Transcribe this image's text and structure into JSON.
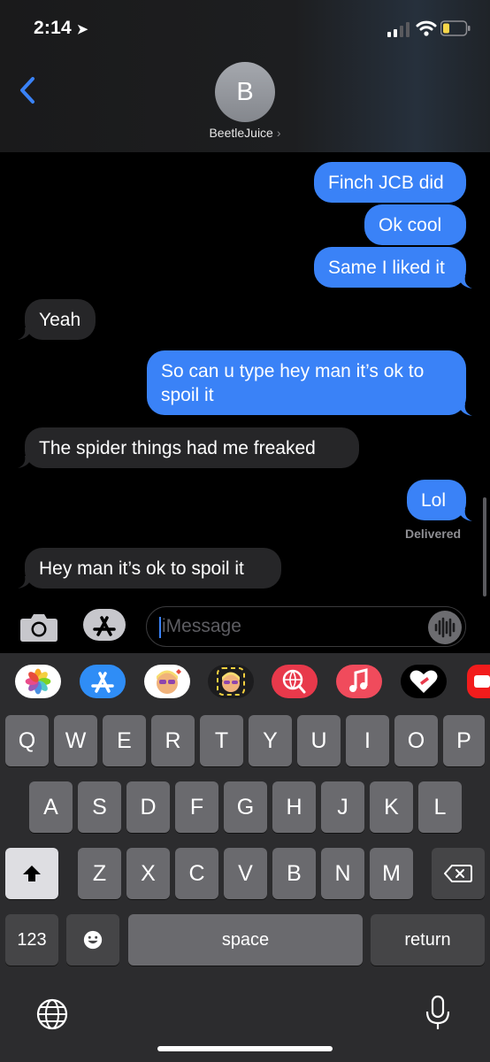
{
  "status_bar": {
    "time": "2:14"
  },
  "header": {
    "avatar_initial": "B",
    "contact_name": "BeetleJuice",
    "contact_chevron": "›"
  },
  "messages": [
    {
      "dir": "out",
      "text": "Finch JCB did"
    },
    {
      "dir": "out",
      "text": "Ok cool"
    },
    {
      "dir": "out",
      "text": "Same I liked it"
    },
    {
      "dir": "in",
      "text": "Yeah"
    },
    {
      "dir": "out",
      "text": "So can u type hey man it’s ok to",
      "text2": "spoil it"
    },
    {
      "dir": "in",
      "text": "The spider things had me freaked"
    },
    {
      "dir": "out",
      "text": "Lol"
    },
    {
      "dir": "in",
      "text": "Hey man it’s ok to spoil it"
    }
  ],
  "delivery_status": "Delivered",
  "composer": {
    "placeholder": "iMessage"
  },
  "app_strip": [
    "photos-app-icon",
    "app-store-icon",
    "memoji-icon",
    "memoji-stickers-icon",
    "web-images-search-icon",
    "music-app-icon",
    "digital-touch-icon",
    "youtube-icon"
  ],
  "keyboard": {
    "row1": [
      "Q",
      "W",
      "E",
      "R",
      "T",
      "Y",
      "U",
      "I",
      "O",
      "P"
    ],
    "row2": [
      "A",
      "S",
      "D",
      "F",
      "G",
      "H",
      "J",
      "K",
      "L"
    ],
    "row3": [
      "Z",
      "X",
      "C",
      "V",
      "B",
      "N",
      "M"
    ],
    "numbers_label": "123",
    "space_label": "space",
    "return_label": "return"
  },
  "colors": {
    "outgoing_bubble": "#3a82f7",
    "incoming_bubble": "#262628",
    "battery_low": "#f7d64a"
  }
}
